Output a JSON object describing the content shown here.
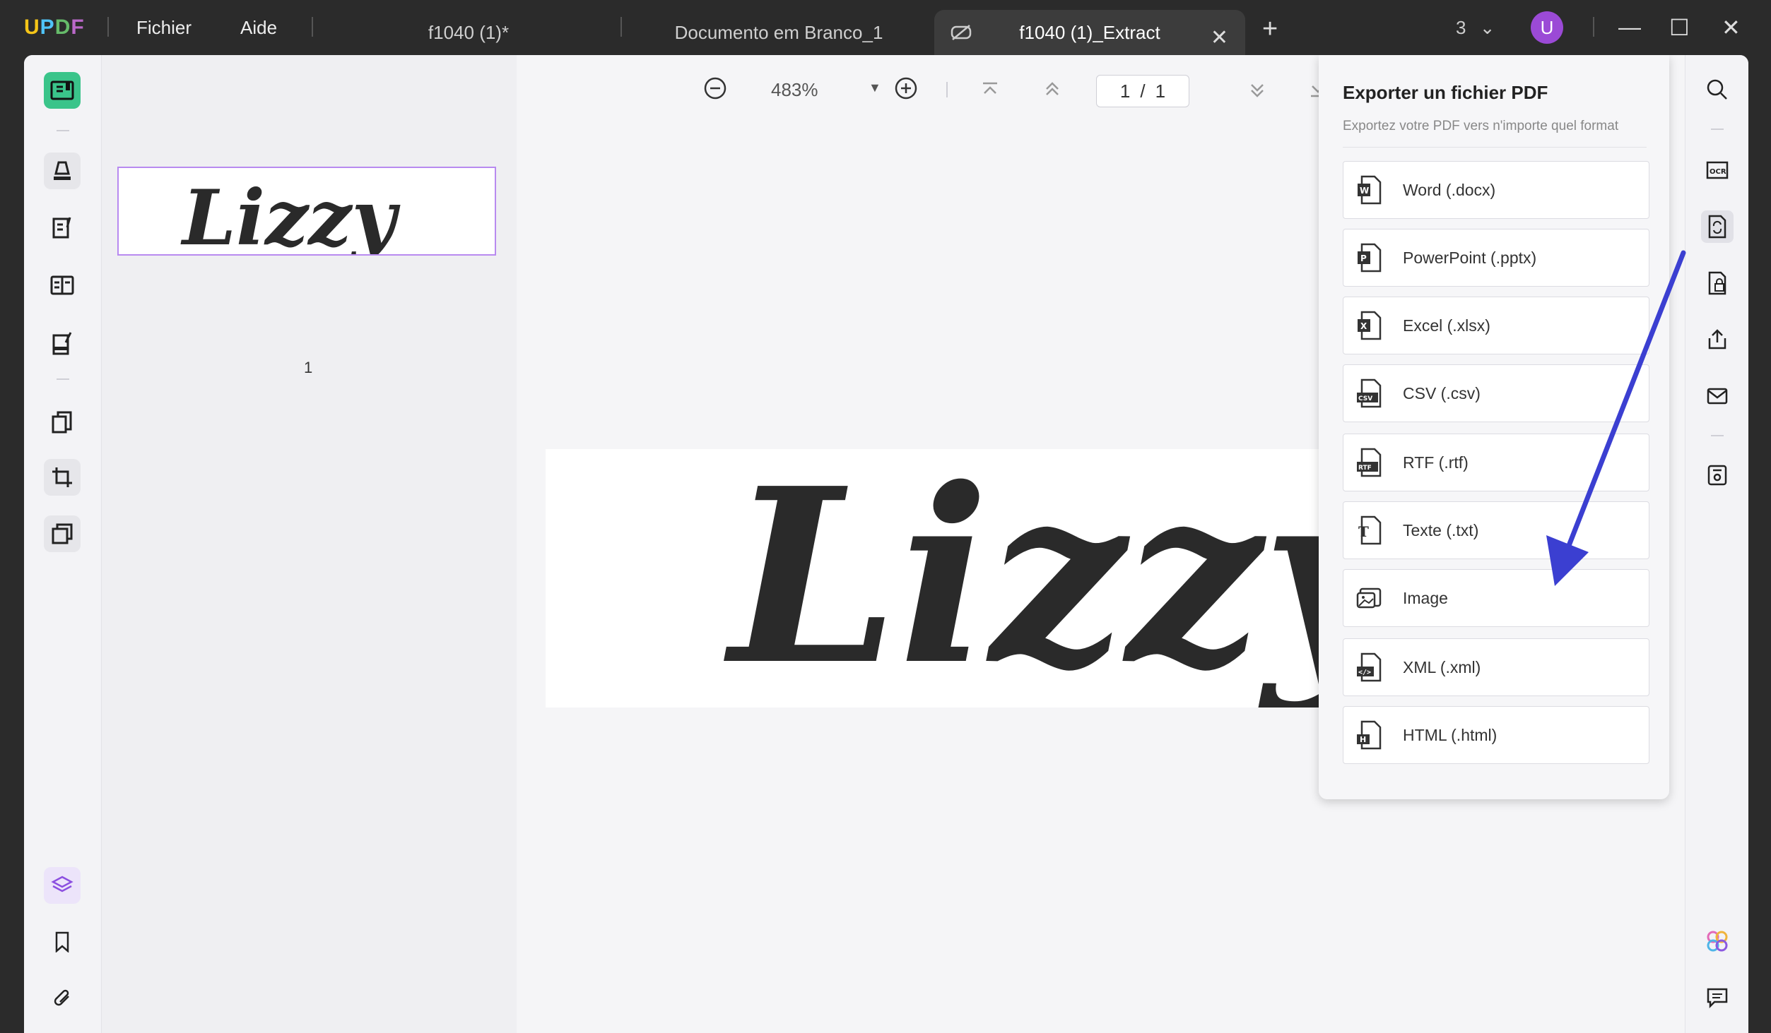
{
  "app": {
    "logo": "UPDF",
    "menu": [
      "Fichier",
      "Aide"
    ],
    "tabs": [
      {
        "label": "f1040 (1)*",
        "active": false
      },
      {
        "label": "Documento em Branco_1",
        "active": false
      },
      {
        "label": "f1040 (1)_Extract",
        "active": true
      }
    ],
    "window_count": "3",
    "avatar_initial": "U"
  },
  "toolbar": {
    "zoom": "483%",
    "current_page": "1",
    "page_separator": "/",
    "total_pages": "1"
  },
  "thumbnails": {
    "page_number": "1",
    "signature_text": "Lizzy"
  },
  "document": {
    "signature_text": "Lizzy"
  },
  "export_panel": {
    "title": "Exporter un fichier PDF",
    "subtitle": "Exportez votre PDF vers n'importe quel format",
    "formats": [
      {
        "label": "Word (.docx)",
        "icon": "word-icon",
        "badge": "W"
      },
      {
        "label": "PowerPoint (.pptx)",
        "icon": "powerpoint-icon",
        "badge": "P"
      },
      {
        "label": "Excel (.xlsx)",
        "icon": "excel-icon",
        "badge": "X"
      },
      {
        "label": "CSV (.csv)",
        "icon": "csv-icon",
        "badge": "CSV"
      },
      {
        "label": "RTF (.rtf)",
        "icon": "rtf-icon",
        "badge": "RTF"
      },
      {
        "label": "Texte (.txt)",
        "icon": "text-icon",
        "badge": "T"
      },
      {
        "label": "Image",
        "icon": "image-icon",
        "badge": ""
      },
      {
        "label": "XML (.xml)",
        "icon": "xml-icon",
        "badge": "</>"
      },
      {
        "label": "HTML (.html)",
        "icon": "html-icon",
        "badge": "H"
      }
    ]
  },
  "colors": {
    "titlebar": "#2b2b2b",
    "accent_green": "#3ac48a",
    "accent_purple": "#9b4ad6",
    "arrow_blue": "#3b3fd1"
  }
}
